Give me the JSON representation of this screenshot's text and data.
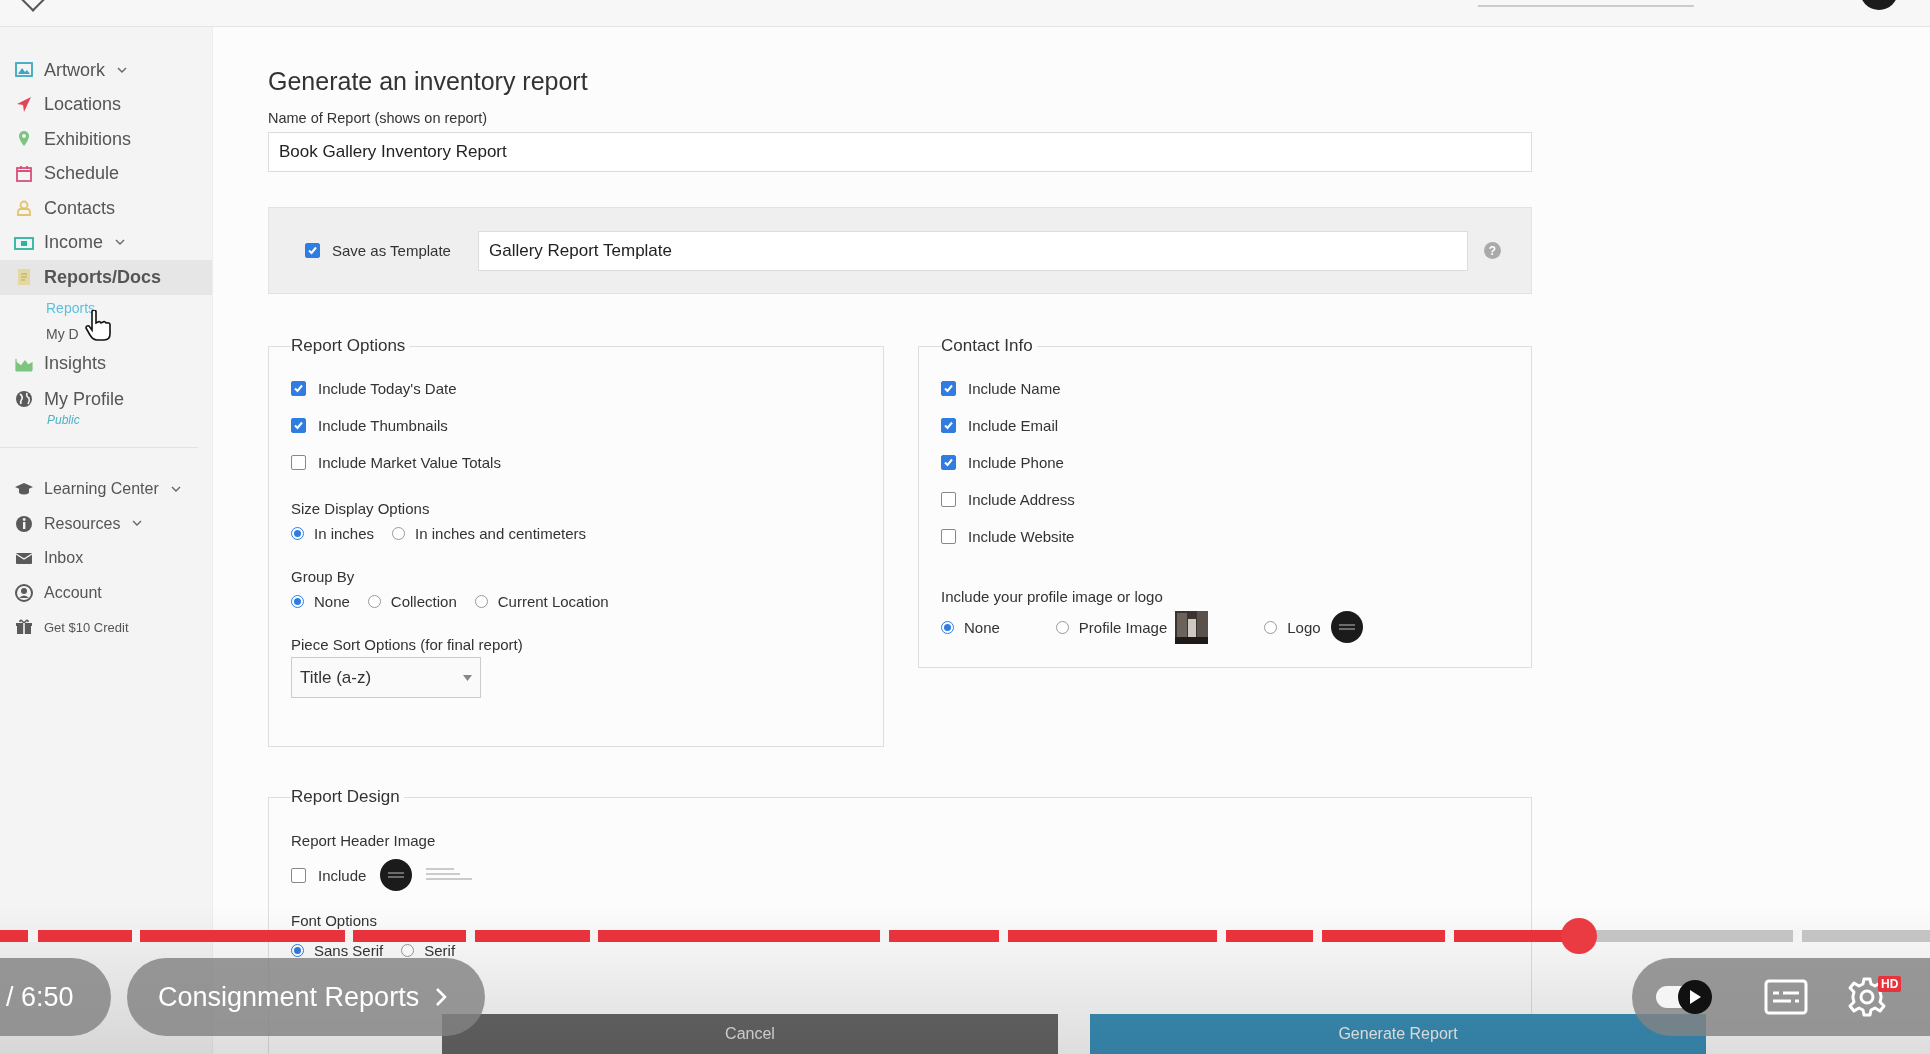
{
  "sidebar": {
    "items": [
      {
        "label": "Artwork",
        "expandable": true,
        "selected": false
      },
      {
        "label": "Locations",
        "expandable": false,
        "selected": false
      },
      {
        "label": "Exhibitions",
        "expandable": false,
        "selected": false
      },
      {
        "label": "Schedule",
        "expandable": false,
        "selected": false
      },
      {
        "label": "Contacts",
        "expandable": false,
        "selected": false
      },
      {
        "label": "Income",
        "expandable": true,
        "selected": false
      },
      {
        "label": "Reports/Docs",
        "expandable": false,
        "selected": true,
        "children": [
          {
            "label": "Reports",
            "selected": true
          },
          {
            "label": "My D",
            "selected": false
          }
        ]
      },
      {
        "label": "Insights",
        "expandable": false,
        "selected": false
      },
      {
        "label": "My Profile",
        "expandable": false,
        "selected": false,
        "status": "Public"
      }
    ],
    "secondary_items": [
      {
        "label": "Learning Center",
        "expandable": true
      },
      {
        "label": "Resources",
        "expandable": true
      },
      {
        "label": "Inbox",
        "expandable": false
      },
      {
        "label": "Account",
        "expandable": false
      },
      {
        "label": "Get $10 Credit",
        "expandable": false,
        "kind": "small"
      }
    ]
  },
  "form": {
    "title": "Generate an inventory report",
    "name_field": {
      "label": "Name of Report (shows on report)",
      "value": "Book Gallery Inventory Report"
    },
    "template": {
      "label": "Save as Template",
      "checked": true,
      "value": "Gallery Report Template",
      "help": "?"
    },
    "report_options": {
      "legend": "Report Options",
      "checkboxes": [
        {
          "label": "Include Today's Date",
          "checked": true
        },
        {
          "label": "Include Thumbnails",
          "checked": true
        },
        {
          "label": "Include Market Value Totals",
          "checked": false
        }
      ],
      "size_display": {
        "label": "Size Display Options",
        "options": [
          {
            "label": "In inches",
            "selected": true
          },
          {
            "label": "In inches and centimeters",
            "selected": false
          }
        ]
      },
      "group_by": {
        "label": "Group By",
        "options": [
          {
            "label": "None",
            "selected": true
          },
          {
            "label": "Collection",
            "selected": false
          },
          {
            "label": "Current Location",
            "selected": false
          }
        ]
      },
      "sort": {
        "label": "Piece Sort Options (for final report)",
        "value": "Title (a-z)"
      }
    },
    "contact_info": {
      "legend": "Contact Info",
      "checkboxes": [
        {
          "label": "Include Name",
          "checked": true
        },
        {
          "label": "Include Email",
          "checked": true
        },
        {
          "label": "Include Phone",
          "checked": true
        },
        {
          "label": "Include Address",
          "checked": false
        },
        {
          "label": "Include Website",
          "checked": false
        }
      ],
      "profile_image": {
        "label": "Include your profile image or logo",
        "options": [
          {
            "label": "None",
            "selected": true,
            "kind": "plain"
          },
          {
            "label": "Profile Image",
            "selected": false
          },
          {
            "label": "Logo",
            "selected": false,
            "kind": "logo"
          }
        ]
      }
    },
    "report_design": {
      "legend": "Report Design",
      "header_image": {
        "label": "Report Header Image",
        "checkbox": {
          "label": "Include",
          "checked": false
        }
      },
      "font_options": {
        "label": "Font Options",
        "options": [
          {
            "label": "Sans Serif",
            "selected": true
          },
          {
            "label": "Serif",
            "selected": false
          }
        ]
      }
    },
    "actions": [
      {
        "label": "Cancel",
        "kind": "secondary"
      },
      {
        "label": "Generate Report",
        "kind": "primary"
      }
    ]
  },
  "video_player": {
    "time": "/ 6:50",
    "chapter": "Consignment Reports",
    "progress": {
      "level": 0.818
    },
    "autoplay": {
      "on": true
    },
    "settings_badge": "HD"
  }
}
